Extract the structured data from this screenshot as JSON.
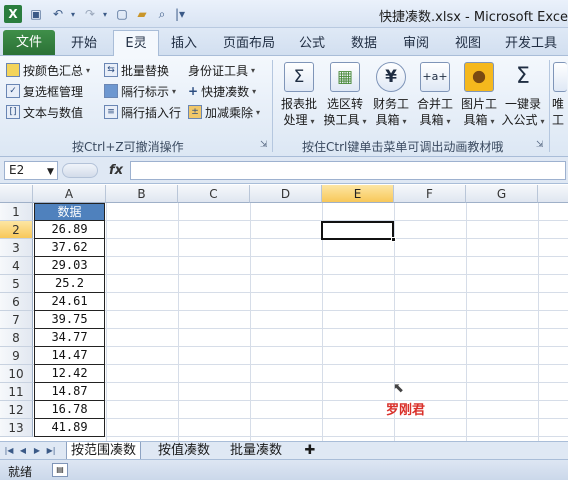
{
  "quick_access": {
    "icons": [
      "excel-logo-icon",
      "save-icon",
      "undo-icon",
      "redo-icon",
      "new-file-icon",
      "open-folder-icon",
      "print-preview-icon",
      "customize-qat-icon"
    ]
  },
  "window": {
    "title": "快捷凑数.xlsx - Microsoft Exce"
  },
  "tabs": [
    {
      "label": "文件"
    },
    {
      "label": "开始"
    },
    {
      "label": "E灵"
    },
    {
      "label": "插入"
    },
    {
      "label": "页面布局"
    },
    {
      "label": "公式"
    },
    {
      "label": "数据"
    },
    {
      "label": "审阅"
    },
    {
      "label": "视图"
    },
    {
      "label": "开发工具"
    }
  ],
  "ribbon": {
    "group1": {
      "items": [
        {
          "label": "按颜色汇总",
          "icon": "color-sum-icon",
          "dropdown": true
        },
        {
          "label": "批量替换",
          "icon": "batch-replace-icon",
          "dropdown": false
        },
        {
          "label": "身份证工具",
          "icon": "",
          "dropdown": true
        },
        {
          "label": "复选框管理",
          "icon": "checkbox-icon",
          "dropdown": false
        },
        {
          "label": "隔行标示",
          "icon": "alternate-rows-icon",
          "dropdown": true
        },
        {
          "label": "快捷凑数",
          "icon": "plus-icon",
          "dropdown": true
        },
        {
          "label": "文本与数值",
          "icon": "text-number-icon",
          "dropdown": false
        },
        {
          "label": "隔行插入行",
          "icon": "insert-rows-icon",
          "dropdown": false
        },
        {
          "label": "加减乘除",
          "icon": "arithmetic-icon",
          "dropdown": true
        }
      ],
      "caption": "按Ctrl+Z可撤消操作"
    },
    "group2": {
      "buttons": [
        {
          "line1": "报表批",
          "line2": "处理",
          "icon": "sigma-report-icon",
          "glyph": "Σ"
        },
        {
          "line1": "选区转",
          "line2": "换工具",
          "icon": "selection-convert-icon",
          "glyph": "▦"
        },
        {
          "line1": "财务工",
          "line2": "具箱",
          "icon": "yen-icon",
          "glyph": "¥"
        },
        {
          "line1": "合并工",
          "line2": "具箱",
          "icon": "merge-icon",
          "glyph": "+a+"
        },
        {
          "line1": "图片工",
          "line2": "具箱",
          "icon": "picture-sunflower-icon",
          "glyph": "✿"
        },
        {
          "line1": "一键录",
          "line2": "入公式",
          "icon": "sigma-formula-icon",
          "glyph": "Σ"
        },
        {
          "line1": "唯",
          "line2": "工",
          "icon": "",
          "glyph": ""
        }
      ],
      "caption": "按住Ctrl键单击菜单可调出动画教材哦"
    }
  },
  "formula_bar": {
    "name_box": "E2",
    "fx": "fx",
    "formula": ""
  },
  "columns": [
    "A",
    "B",
    "C",
    "D",
    "E",
    "F",
    "G"
  ],
  "rows": [
    "1",
    "2",
    "3",
    "4",
    "5",
    "6",
    "7",
    "8",
    "9",
    "10",
    "11",
    "12",
    "13"
  ],
  "table": {
    "header": "数据",
    "values": [
      "26.89",
      "37.62",
      "29.03",
      "25.2",
      "24.61",
      "39.75",
      "34.77",
      "14.47",
      "12.42",
      "14.87",
      "16.78",
      "41.89"
    ]
  },
  "selected_cell": "E2",
  "watermark": "罗刚君",
  "sheets": [
    {
      "label": "按范围凑数"
    },
    {
      "label": "按值凑数"
    },
    {
      "label": "批量凑数"
    }
  ],
  "status": {
    "text": "就绪"
  }
}
